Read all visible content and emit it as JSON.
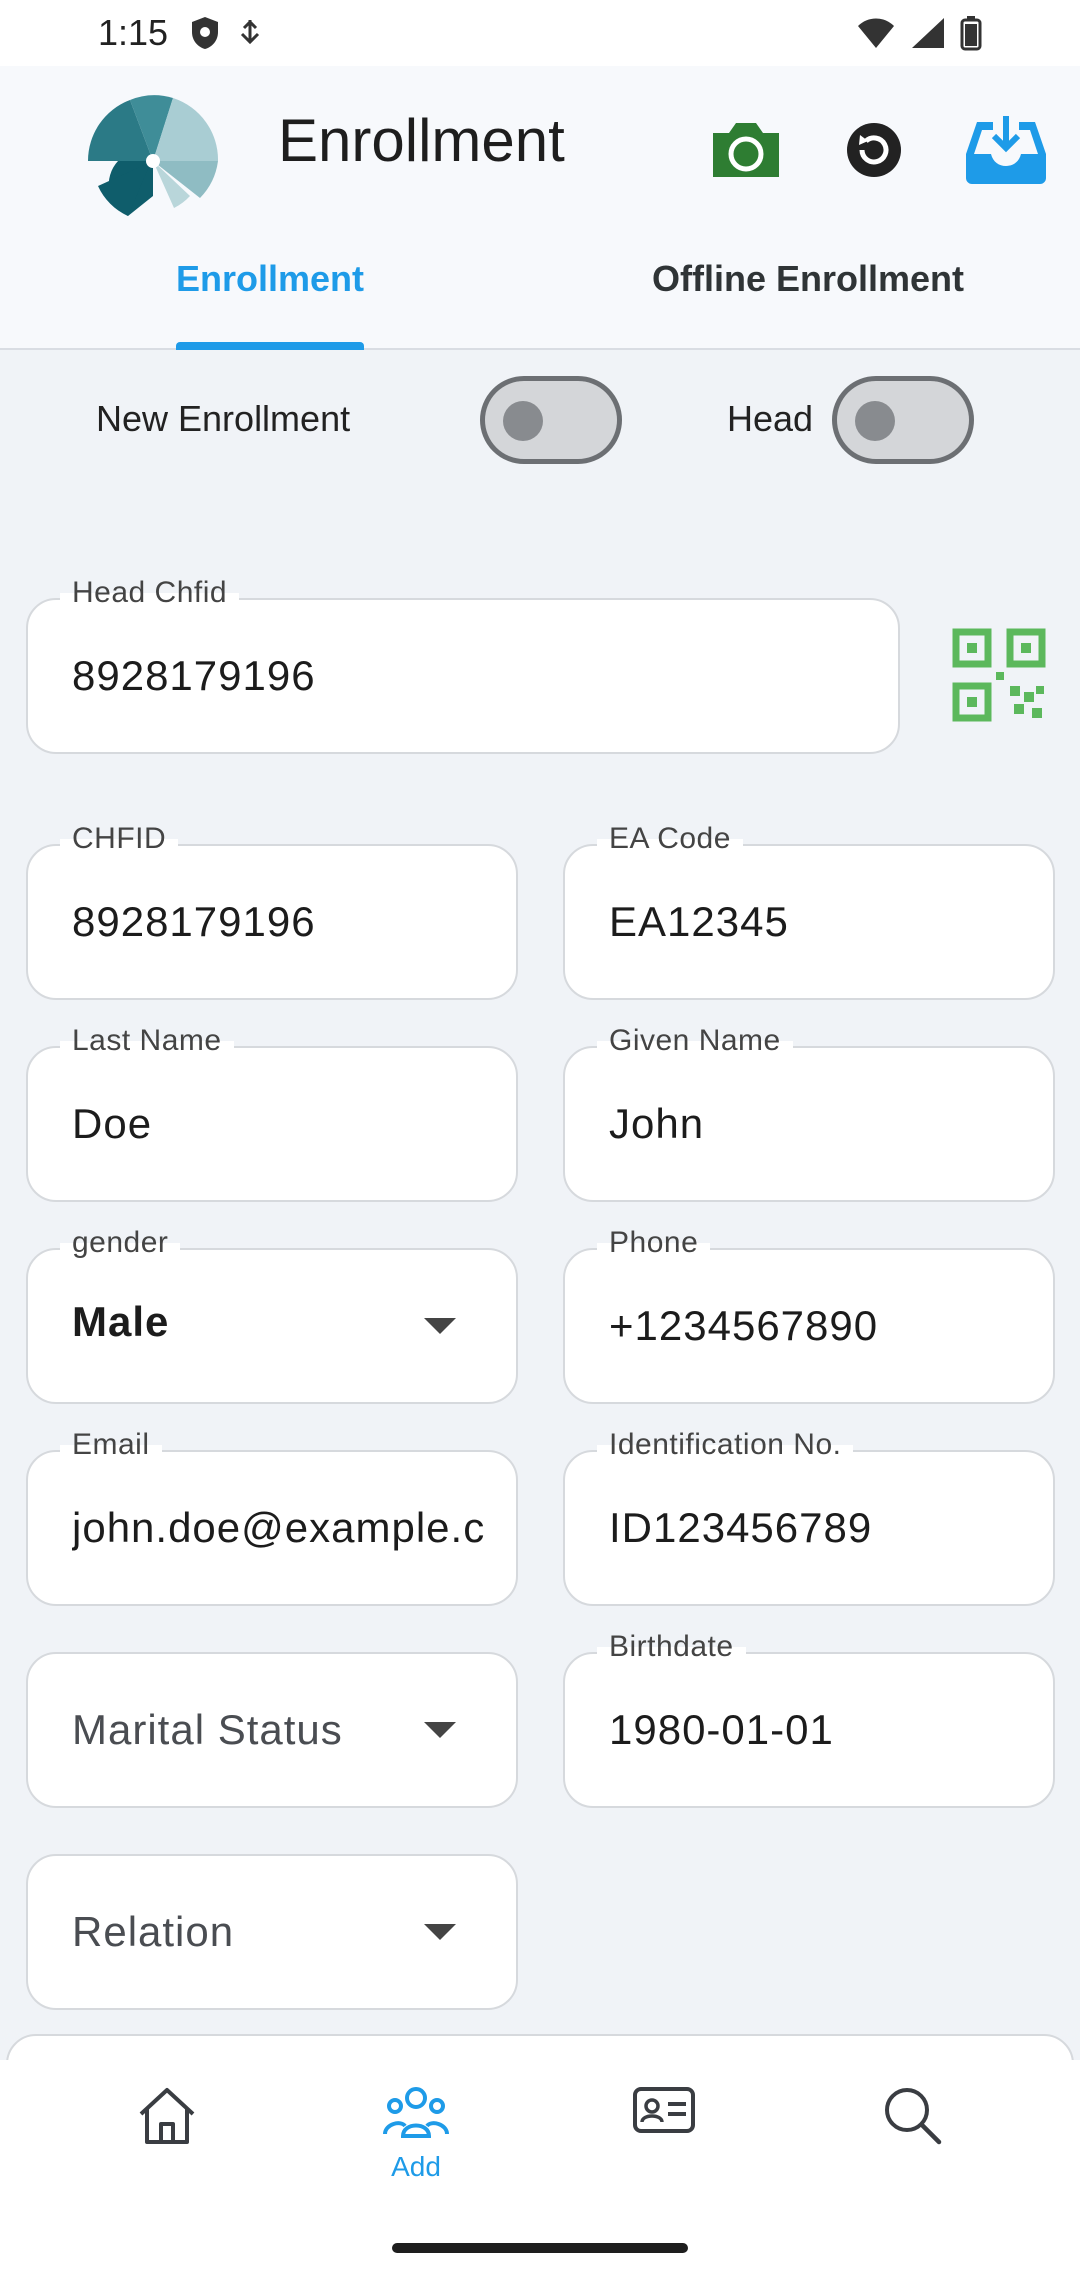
{
  "status_bar": {
    "time": "1:15"
  },
  "header": {
    "title": "Enrollment"
  },
  "tabs": [
    {
      "label": "Enrollment",
      "active": true
    },
    {
      "label": "Offline Enrollment",
      "active": false
    }
  ],
  "toggles": {
    "new_enrollment": {
      "label": "New Enrollment",
      "on": false
    },
    "head": {
      "label": "Head",
      "on": false
    }
  },
  "form": {
    "head_chfid": {
      "label": "Head Chfid",
      "value": "8928179196"
    },
    "chfid": {
      "label": "CHFID",
      "value": "8928179196"
    },
    "ea_code": {
      "label": "EA Code",
      "value": "EA12345"
    },
    "last_name": {
      "label": "Last Name",
      "value": "Doe"
    },
    "given_name": {
      "label": "Given Name",
      "value": "John"
    },
    "gender": {
      "label": "gender",
      "value": "Male"
    },
    "phone": {
      "label": "Phone",
      "value": "+1234567890"
    },
    "email": {
      "label": "Email",
      "value": "john.doe@example.com"
    },
    "identification": {
      "label": "Identification No.",
      "value": "ID123456789"
    },
    "marital_status": {
      "placeholder": "Marital Status"
    },
    "birthdate": {
      "label": "Birthdate",
      "value": "1980-01-01"
    },
    "relation": {
      "placeholder": "Relation"
    }
  },
  "bottom_nav": {
    "items": [
      {
        "icon": "home-icon",
        "label": ""
      },
      {
        "icon": "people-icon",
        "label": "Add",
        "active": true
      },
      {
        "icon": "id-card-icon",
        "label": ""
      },
      {
        "icon": "search-icon",
        "label": ""
      }
    ]
  },
  "colors": {
    "accent": "#1e9be8",
    "camera": "#2e7d32",
    "qr": "#5cb85c",
    "logo_teal": "#2b7a86"
  }
}
